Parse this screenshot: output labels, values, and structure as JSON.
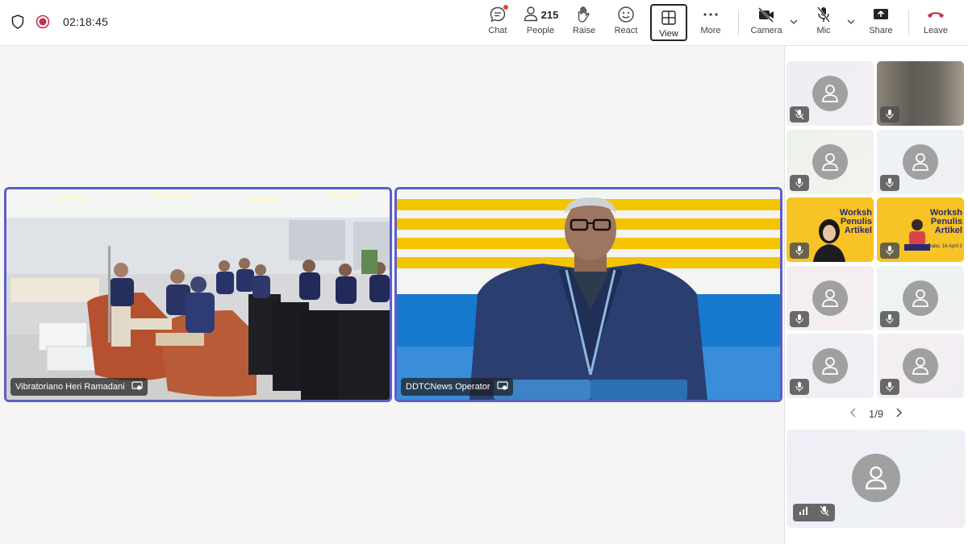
{
  "meeting": {
    "timer": "02:18:45",
    "recording": true
  },
  "toolbar": {
    "chat_label": "Chat",
    "people_label": "People",
    "people_count": "215",
    "raise_label": "Raise",
    "react_label": "React",
    "view_label": "View",
    "more_label": "More",
    "camera_label": "Camera",
    "mic_label": "Mic",
    "share_label": "Share",
    "leave_label": "Leave"
  },
  "stage": {
    "videos": [
      {
        "name": "Vibratoriano Heri Ramadani"
      },
      {
        "name": "DDTCNews Operator"
      }
    ]
  },
  "gallery": {
    "page": "1/9",
    "promo_title_line1": "Worksh",
    "promo_title_line2": "Penulis",
    "promo_title_line3": "Artikel",
    "promo_date": "Rabu, 16 April 2"
  },
  "colors": {
    "accent": "#5b5fc7",
    "recording": "#c4314b",
    "leave": "#c4314b",
    "notification": "#e8462a"
  },
  "icons": [
    "shield-icon",
    "record-icon",
    "chat-icon",
    "people-icon",
    "raise-hand-icon",
    "react-icon",
    "view-icon",
    "more-icon",
    "camera-off-icon",
    "chevron-down-icon",
    "mic-off-icon",
    "share-icon",
    "leave-icon",
    "person-icon",
    "mic-muted-icon",
    "mic-icon",
    "signal-icon",
    "chevron-left-icon",
    "chevron-right-icon",
    "screen-share-icon"
  ]
}
